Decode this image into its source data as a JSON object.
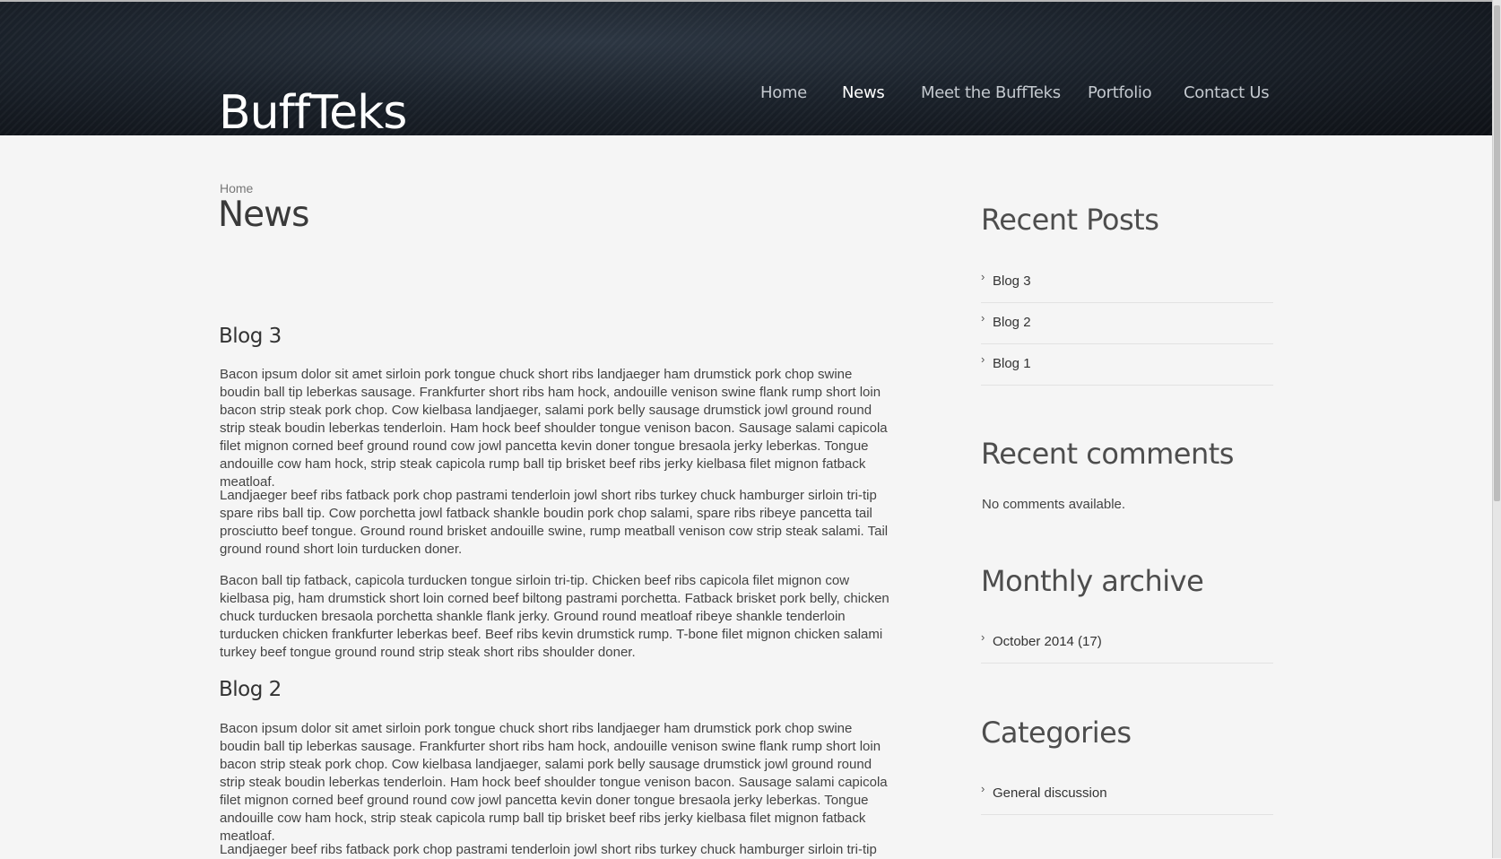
{
  "header": {
    "logo": "BuffTeks",
    "nav": [
      "Home",
      "News",
      "Meet the BuffTeks",
      "Portfolio",
      "Contact Us"
    ],
    "active": "News"
  },
  "breadcrumb": "Home",
  "page_title": "News",
  "posts": [
    {
      "title": "Blog 3",
      "paragraphs": [
        "Bacon ipsum dolor sit amet sirloin pork tongue chuck short ribs landjaeger ham drumstick pork chop swine boudin ball tip leberkas sausage. Frankfurter short ribs ham hock, andouille venison swine flank rump short loin bacon strip steak pork chop. Cow kielbasa landjaeger, salami pork belly sausage drumstick jowl ground round strip steak boudin leberkas tenderloin. Ham hock beef shoulder tongue venison bacon. Sausage salami capicola filet mignon corned beef ground round cow jowl pancetta kevin doner tongue bresaola jerky leberkas. Tongue andouille cow ham hock, strip steak capicola rump ball tip brisket beef ribs jerky kielbasa filet mignon fatback meatloaf.",
        "Landjaeger beef ribs fatback pork chop pastrami tenderloin jowl short ribs turkey chuck hamburger sirloin tri-tip spare ribs ball tip. Cow porchetta jowl fatback shankle boudin pork chop salami, spare ribs ribeye pancetta tail prosciutto beef tongue. Ground round brisket andouille swine, rump meatball venison cow strip steak salami. Tail ground round short loin turducken doner.",
        "Bacon ball tip fatback, capicola turducken tongue sirloin tri-tip. Chicken beef ribs capicola filet mignon cow kielbasa pig, ham drumstick short loin corned beef biltong pastrami porchetta. Fatback brisket pork belly, chicken chuck turducken bresaola porchetta shankle flank jerky. Ground round meatloaf ribeye shankle tenderloin turducken chicken frankfurter leberkas beef. Beef ribs kevin drumstick rump. T-bone filet mignon chicken salami turkey beef tongue ground round strip steak short ribs shoulder doner."
      ]
    },
    {
      "title": "Blog 2",
      "paragraphs": [
        "Bacon ipsum dolor sit amet sirloin pork tongue chuck short ribs landjaeger ham drumstick pork chop swine boudin ball tip leberkas sausage. Frankfurter short ribs ham hock, andouille venison swine flank rump short loin bacon strip steak pork chop. Cow kielbasa landjaeger, salami pork belly sausage drumstick jowl ground round strip steak boudin leberkas tenderloin. Ham hock beef shoulder tongue venison bacon. Sausage salami capicola filet mignon corned beef ground round cow jowl pancetta kevin doner tongue bresaola jerky leberkas. Tongue andouille cow ham hock, strip steak capicola rump ball tip brisket beef ribs jerky kielbasa filet mignon fatback meatloaf.",
        "Landjaeger beef ribs fatback pork chop pastrami tenderloin jowl short ribs turkey chuck hamburger sirloin tri-tip"
      ]
    }
  ],
  "sidebar": {
    "recent_posts": {
      "title": "Recent Posts",
      "items": [
        "Blog 3",
        "Blog 2",
        "Blog 1"
      ]
    },
    "recent_comments": {
      "title": "Recent comments",
      "empty": "No comments available."
    },
    "monthly_archive": {
      "title": "Monthly archive",
      "items": [
        "October 2014 (17)"
      ]
    },
    "categories": {
      "title": "Categories",
      "items": [
        "General discussion"
      ]
    }
  }
}
